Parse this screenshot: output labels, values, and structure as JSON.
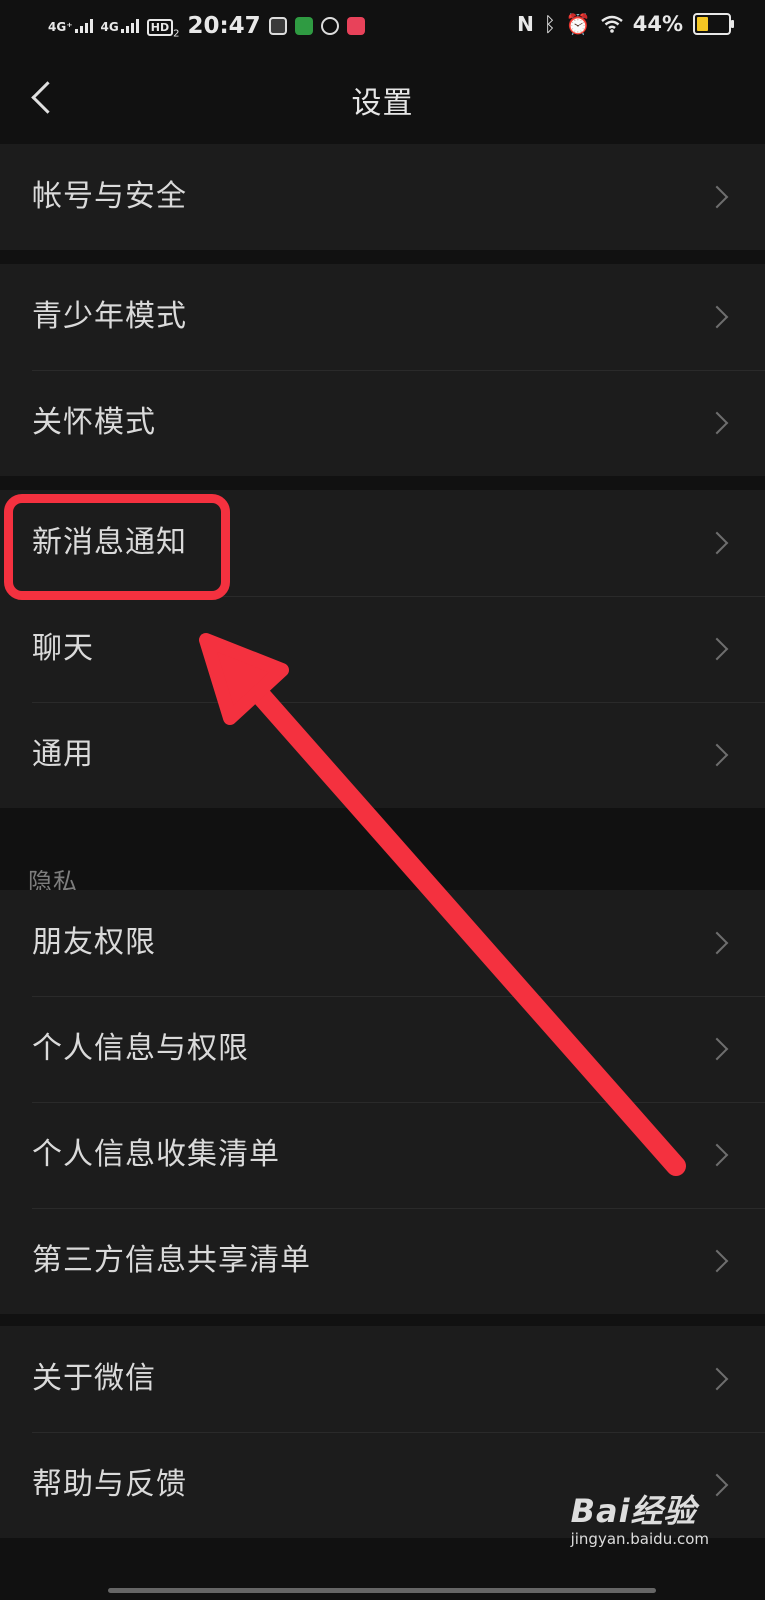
{
  "status_bar": {
    "network_1": "4G⁺",
    "network_2": "4G",
    "hd": "HD",
    "hd_sub": "2",
    "time": "20:47",
    "nfc": "N",
    "battery_percent": "44%",
    "battery_level": 0.44,
    "battery_color": "#f3c623"
  },
  "nav": {
    "title": "设置",
    "back_icon": "chevron-left-icon"
  },
  "groups": {
    "g1": [
      "帐号与安全"
    ],
    "g2": [
      "青少年模式",
      "关怀模式"
    ],
    "g3": [
      "新消息通知",
      "聊天",
      "通用"
    ],
    "privacy_label": "隐私",
    "g4": [
      "朋友权限",
      "个人信息与权限",
      "个人信息收集清单",
      "第三方信息共享清单"
    ],
    "g5": [
      "关于微信",
      "帮助与反馈"
    ]
  },
  "annotation": {
    "highlight_color": "#f4313f",
    "highlighted_item": "新消息通知"
  },
  "watermark": {
    "logo": "Bai经验",
    "url": "jingyan.baidu.com"
  }
}
